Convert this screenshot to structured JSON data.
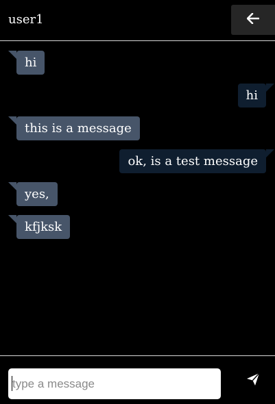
{
  "header": {
    "username": "user1",
    "back_icon": "arrow-left-icon"
  },
  "messages": [
    {
      "side": "received",
      "text": "hi"
    },
    {
      "side": "sent",
      "text": "hi"
    },
    {
      "side": "received",
      "text": "this is a message"
    },
    {
      "side": "sent",
      "text": "ok, is a test message"
    },
    {
      "side": "received",
      "text": "yes,"
    },
    {
      "side": "received",
      "text": "kfjksk"
    }
  ],
  "composer": {
    "placeholder": "type a message",
    "value": "",
    "send_icon": "paper-plane-icon"
  },
  "colors": {
    "background": "#000000",
    "received_bubble": "#475569",
    "sent_bubble": "#0f1e2f",
    "header_button": "#262626",
    "divider": "#d9d9d9"
  }
}
